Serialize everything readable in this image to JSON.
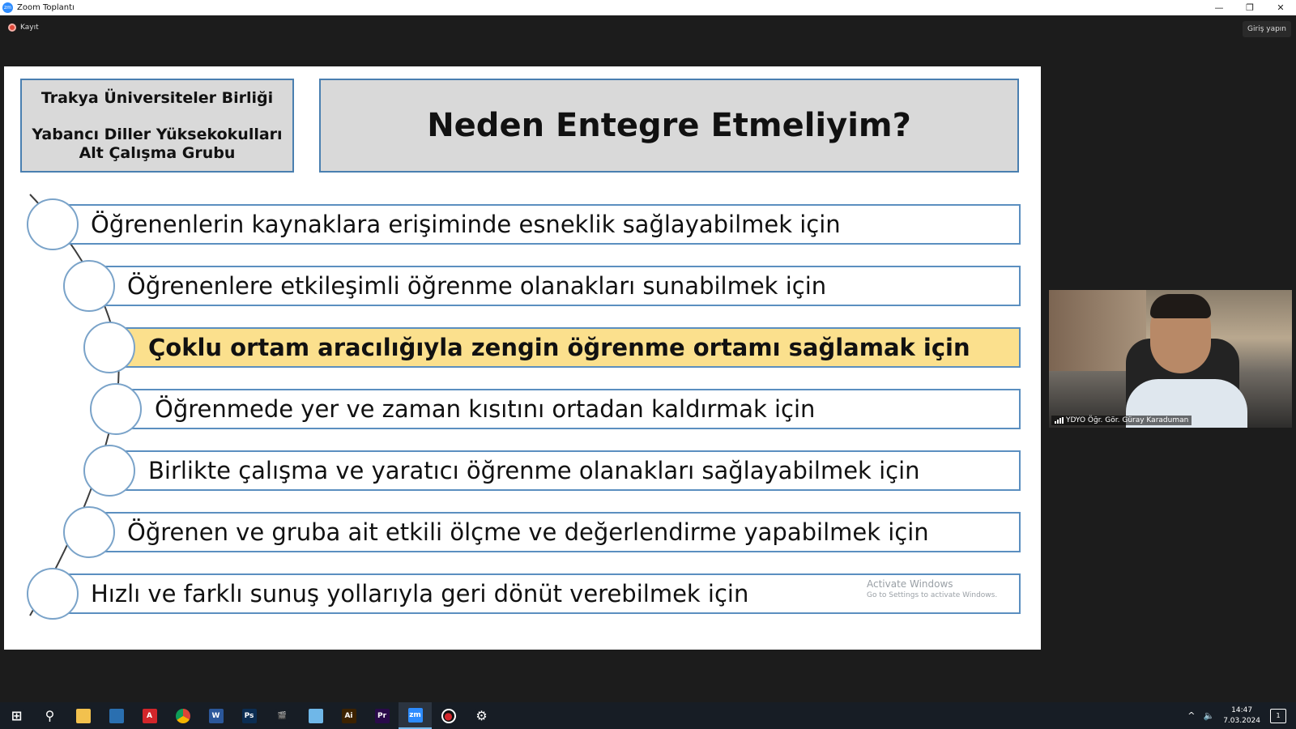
{
  "window": {
    "app_icon_text": "zm",
    "title": "Zoom Toplantı",
    "minimize_symbol": "—",
    "restore_symbol": "❐",
    "close_symbol": "✕"
  },
  "toolbar": {
    "recording_label": "Kayıt",
    "signin_label": "Giriş yapın"
  },
  "slide": {
    "header_left": {
      "line1": "Trakya Üniversiteler Birliği",
      "line2": "Yabancı Diller Yüksekokulları",
      "line3": "Alt Çalışma Grubu"
    },
    "title": "Neden Entegre Etmeliyim?",
    "items": [
      {
        "text": "Öğrenenlerin kaynaklara erişiminde esneklik sağlayabilmek için",
        "highlighted": false
      },
      {
        "text": "Öğrenenlere etkileşimli öğrenme olanakları sunabilmek için",
        "highlighted": false
      },
      {
        "text": "Çoklu ortam aracılığıyla zengin öğrenme ortamı sağlamak için",
        "highlighted": true
      },
      {
        "text": "Öğrenmede yer ve zaman kısıtını ortadan kaldırmak için",
        "highlighted": false
      },
      {
        "text": "Birlikte çalışma ve yaratıcı öğrenme olanakları sağlayabilmek için",
        "highlighted": false
      },
      {
        "text": "Öğrenen ve gruba ait etkili ölçme ve değerlendirme yapabilmek için",
        "highlighted": false
      },
      {
        "text": "Hızlı ve farklı sunuş yollarıyla geri dönüt verebilmek için",
        "highlighted": false
      }
    ],
    "watermark": {
      "line1": "Activate Windows",
      "line2": "Go to Settings to activate Windows."
    }
  },
  "video": {
    "participant_name": "YDYO Öğr. Gör. Güray Karaduman"
  },
  "taskbar": {
    "apps": [
      {
        "name": "start",
        "glyph": "⊞",
        "color": "#171d25"
      },
      {
        "name": "search",
        "glyph": "⚲",
        "color": "#171d25"
      },
      {
        "name": "file-explorer",
        "glyph": "",
        "color": "#f2c14e"
      },
      {
        "name": "screen",
        "glyph": "",
        "color": "#2a6fb0"
      },
      {
        "name": "acrobat",
        "glyph": "A",
        "color": "#d3262b"
      },
      {
        "name": "chrome",
        "glyph": "",
        "color": "#e8a33d"
      },
      {
        "name": "word",
        "glyph": "W",
        "color": "#2b579a"
      },
      {
        "name": "photoshop",
        "glyph": "Ps",
        "color": "#0c2d52"
      },
      {
        "name": "movie-maker",
        "glyph": "🎬",
        "color": "#171d25"
      },
      {
        "name": "notes",
        "glyph": "",
        "color": "#6fb7e8"
      },
      {
        "name": "illustrator",
        "glyph": "Ai",
        "color": "#3c2200"
      },
      {
        "name": "premiere",
        "glyph": "Pr",
        "color": "#2a0a4a"
      },
      {
        "name": "zoom",
        "glyph": "zm",
        "color": "#2d8cff"
      },
      {
        "name": "recorder",
        "glyph": "●",
        "color": "#d3262b"
      },
      {
        "name": "settings",
        "glyph": "⚙",
        "color": "#171d25"
      }
    ],
    "active_app": "zoom",
    "tray_chevron": "^",
    "tray_volume": "🔈",
    "time": "14:47",
    "date": "7.03.2024",
    "notification_count": "1"
  }
}
